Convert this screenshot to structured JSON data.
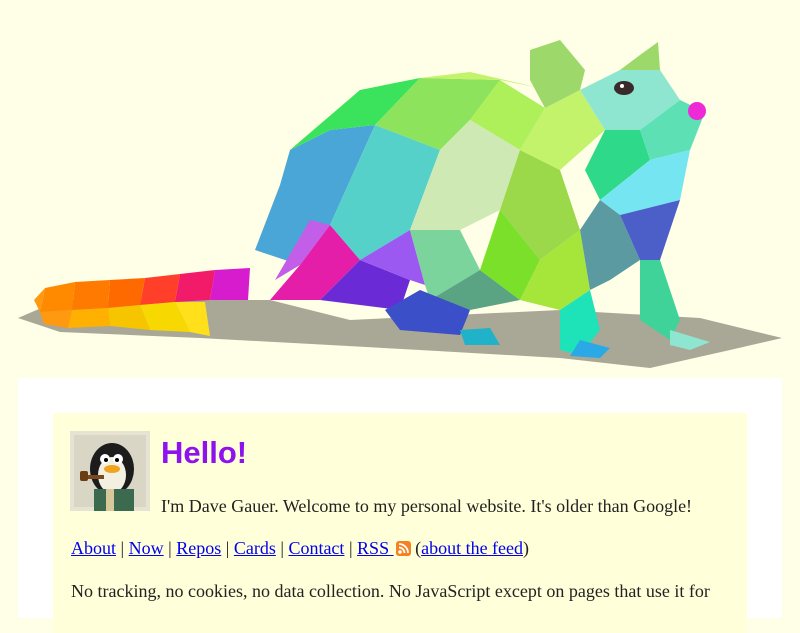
{
  "hero": {
    "image": "low-poly-rat-icon",
    "tail_colors": [
      "#f7b900",
      "#ff8a00",
      "#ff6a00",
      "#ff3f2a",
      "#f21b6a",
      "#e51ea9",
      "#d61ccd"
    ],
    "body_colors": [
      "#c3f26b",
      "#3ae35b",
      "#8ee35c",
      "#4aa6d6",
      "#55d1b2",
      "#9b59f2",
      "#6a2bd6",
      "#1b5ad6"
    ]
  },
  "intro": {
    "avatar": "penguin-with-pipe-avatar",
    "greeting": "Hello!",
    "text": "I'm Dave Gauer. Welcome to my personal website. It's older than Google!"
  },
  "nav": {
    "links": [
      {
        "label": "About"
      },
      {
        "label": "Now"
      },
      {
        "label": "Repos"
      },
      {
        "label": "Cards"
      },
      {
        "label": "Contact"
      },
      {
        "label": "RSS"
      }
    ],
    "separator": " | ",
    "feed_link": "about the feed",
    "feed_open": " (",
    "feed_close": ")"
  },
  "notice": {
    "text": "No tracking, no cookies, no data collection. No JavaScript except on pages that use it for"
  },
  "colors": {
    "page_bg": "#fffee6",
    "card_bg": "#ffffd9",
    "greeting": "#8e12ee",
    "link": "#0000ee",
    "rss": "#f58220"
  }
}
